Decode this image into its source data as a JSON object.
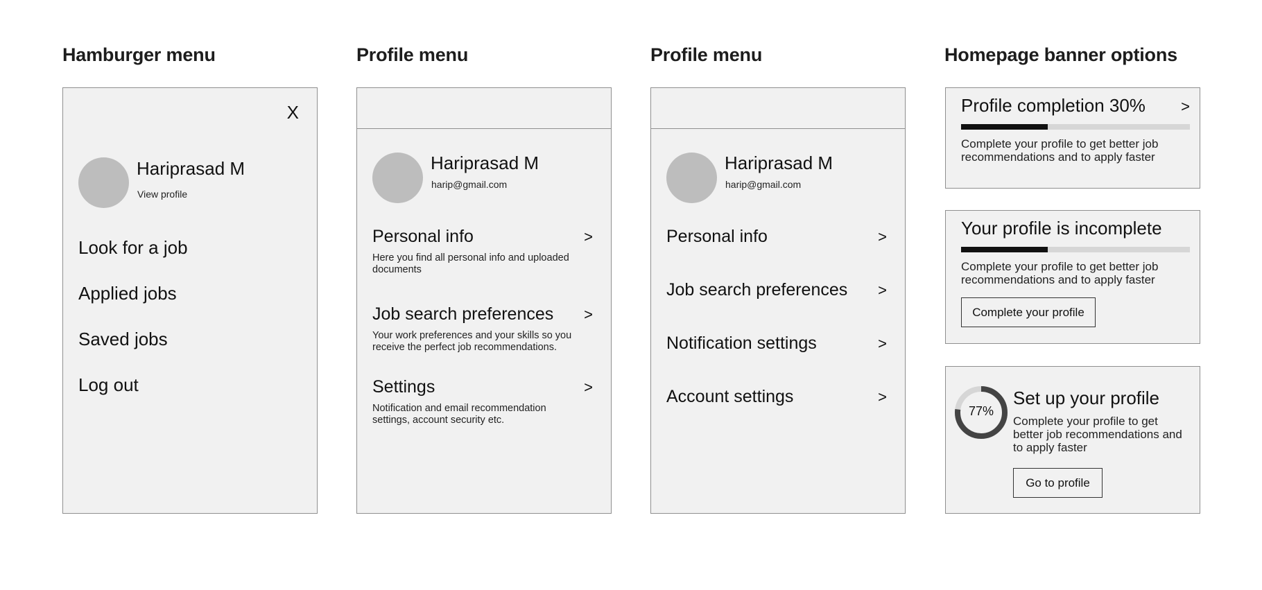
{
  "columns": {
    "hamburger_title": "Hamburger menu",
    "profile1_title": "Profile menu",
    "profile2_title": "Profile menu",
    "banner_title": "Homepage banner options"
  },
  "hamburger": {
    "close_label": "X",
    "user_name": "Hariprasad M",
    "view_profile": "View profile",
    "items": [
      "Look for a job",
      "Applied jobs",
      "Saved jobs",
      "Log out"
    ]
  },
  "profile_menu_detailed": {
    "user_name": "Hariprasad M",
    "email": "harip@gmail.com",
    "items": [
      {
        "label": "Personal info",
        "arrow": ">",
        "desc": "Here you find all personal info and uploaded documents"
      },
      {
        "label": "Job search preferences",
        "arrow": ">",
        "desc": "Your work preferences and your skills so you receive the perfect job recommendations."
      },
      {
        "label": "Settings",
        "arrow": ">",
        "desc": "Notification and email recommendation settings, account security etc."
      }
    ]
  },
  "profile_menu_simple": {
    "user_name": "Hariprasad M",
    "email": "harip@gmail.com",
    "items": [
      {
        "label": "Personal info",
        "arrow": ">"
      },
      {
        "label": "Job search preferences",
        "arrow": ">"
      },
      {
        "label": "Notification settings",
        "arrow": ">"
      },
      {
        "label": "Account settings",
        "arrow": ">"
      }
    ]
  },
  "banners": {
    "completion": {
      "title": "Profile completion 30%",
      "arrow": ">",
      "progress": 0.38,
      "text": "Complete your profile to get better job recommendations and to apply faster"
    },
    "incomplete": {
      "title": "Your profile is incomplete",
      "progress": 0.38,
      "text": "Complete your profile to get better job recommendations and to apply faster",
      "button": "Complete your profile"
    },
    "setup": {
      "percent_label": "77%",
      "progress": 0.77,
      "title": "Set up your profile",
      "text": "Complete your profile to get better job recommendations and to apply faster",
      "button": "Go to profile"
    }
  },
  "colors": {
    "panel_bg": "#f1f1f1",
    "border": "#8f8f8f",
    "avatar": "#bdbdbd",
    "progress_fill": "#111111",
    "progress_track": "#d6d6d6",
    "ring_fill": "#444444"
  }
}
